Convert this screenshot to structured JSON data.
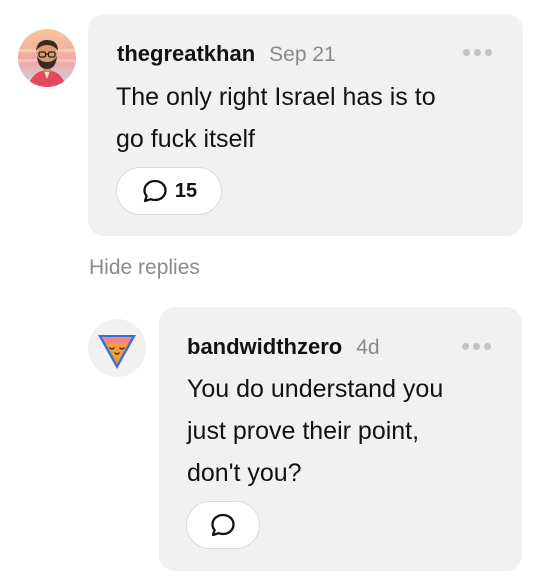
{
  "comment": {
    "username": "thegreatkhan",
    "timestamp": "Sep 21",
    "body_lines": [
      "The only right Israel has is to",
      "go fuck itself"
    ],
    "reply_count": "15",
    "avatar_icon": "bearded-man-avatar-icon"
  },
  "hide_replies_label": "Hide replies",
  "reply": {
    "username": "bandwidthzero",
    "timestamp": "4d",
    "body_lines": [
      "You do understand you",
      "just prove their point,",
      "don't you?"
    ],
    "avatar_icon": "ice-cream-cone-avatar-icon"
  },
  "icons": {
    "more": "more-dots-icon",
    "speech": "speech-bubble-icon"
  },
  "colors": {
    "bubble_bg": "#f1f1f1",
    "muted_text": "#8a8a8a",
    "cone_orange": "#f29d3a",
    "cone_pink": "#f0868b",
    "cone_blue": "#3f6fd6"
  }
}
